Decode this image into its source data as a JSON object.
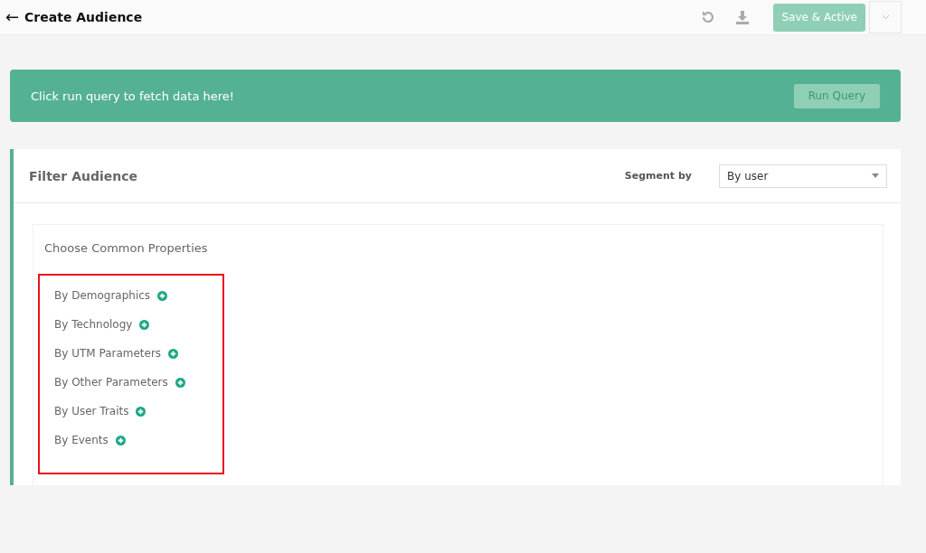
{
  "header": {
    "back_icon": "←",
    "title": "Create Audience",
    "save_button": "Save & Active"
  },
  "banner": {
    "message": "Click run query to fetch data here!",
    "run_button": "Run Query"
  },
  "filter": {
    "title": "Filter Audience",
    "segment_label": "Segment by",
    "segment_value": "By user"
  },
  "properties": {
    "title": "Choose Common Properties",
    "items": [
      {
        "label": "By Demographics"
      },
      {
        "label": "By Technology"
      },
      {
        "label": "By UTM Parameters"
      },
      {
        "label": "By Other Parameters"
      },
      {
        "label": "By User Traits"
      },
      {
        "label": "By Events"
      }
    ]
  }
}
